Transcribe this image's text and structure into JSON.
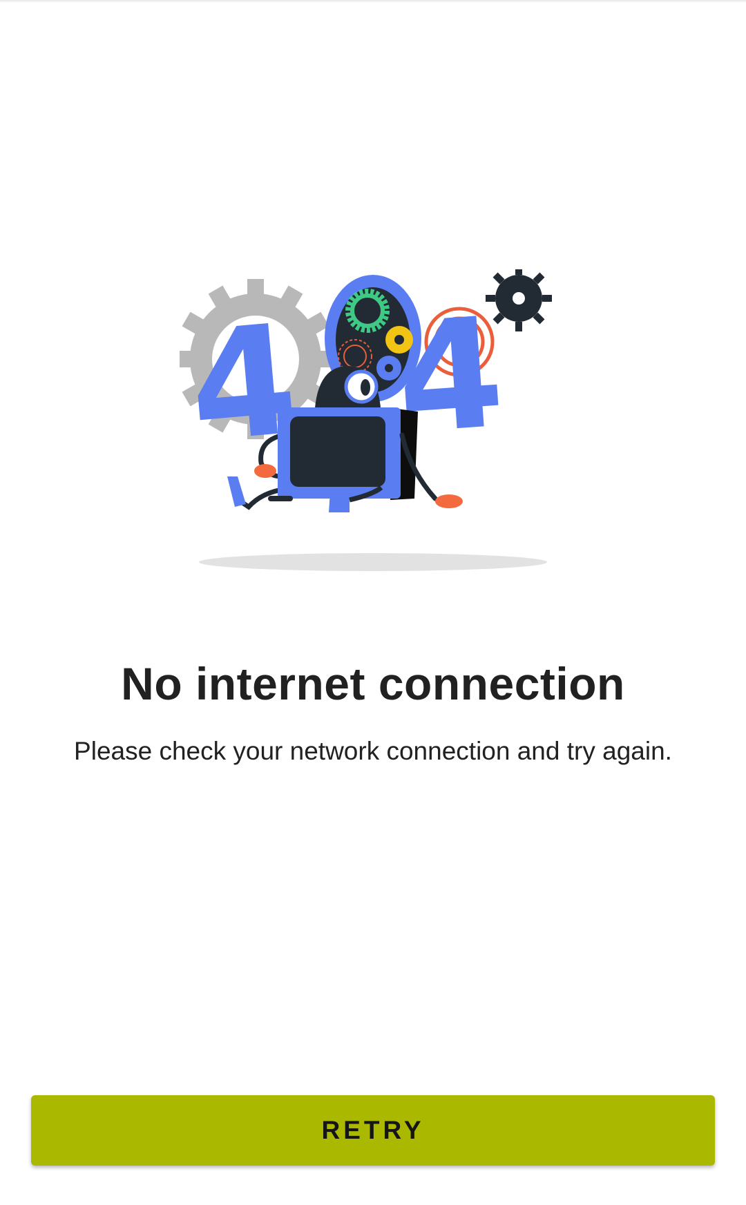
{
  "illustration": {
    "digits": [
      "4",
      "4"
    ],
    "colors": {
      "digit_blue": "#5a7df1",
      "dark": "#222b33",
      "gear_gray": "#b8b8b8",
      "gear_green": "#3ec985",
      "gear_yellow": "#f2c414",
      "gear_orange": "#ea5e3c",
      "hand_orange": "#f26a3d",
      "shadow": "#e2e2e2"
    }
  },
  "content": {
    "title": "No internet connection",
    "message": "Please check your network connection and try again."
  },
  "actions": {
    "retry_label": "RETRY",
    "retry_color": "#abb800"
  }
}
